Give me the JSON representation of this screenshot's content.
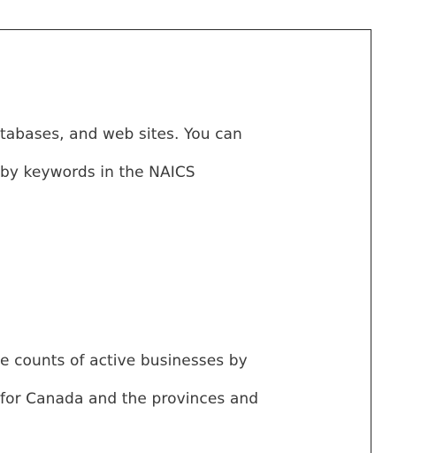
{
  "content": {
    "lines": [
      "tabases, and web sites. You can",
      " by keywords in the NAICS",
      "e counts of active businesses by",
      "for Canada and the provinces and"
    ]
  }
}
